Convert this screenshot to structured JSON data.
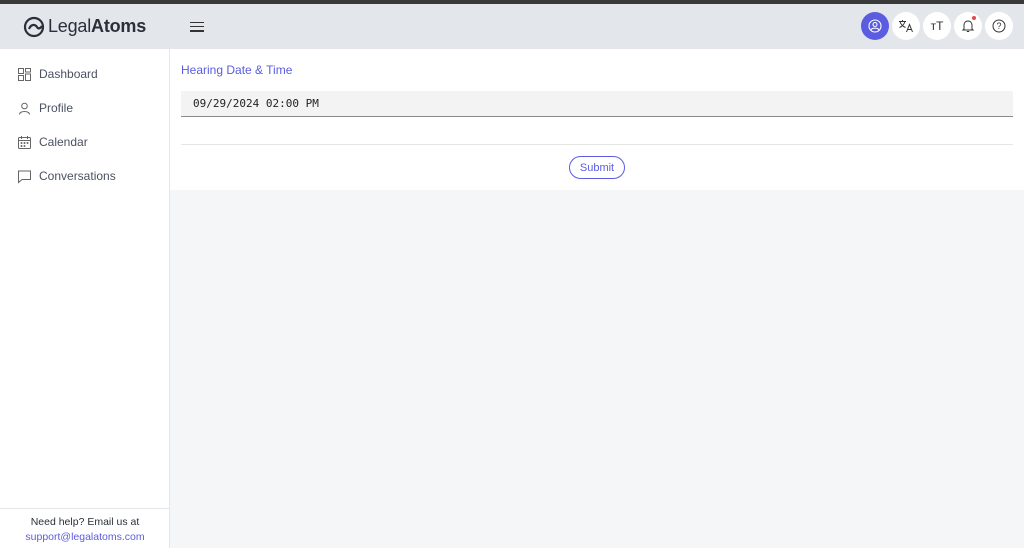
{
  "brand": {
    "name_light": "Legal",
    "name_bold": "Atoms"
  },
  "sidebar": {
    "items": [
      {
        "label": "Dashboard",
        "icon": "grid-icon"
      },
      {
        "label": "Profile",
        "icon": "user-icon"
      },
      {
        "label": "Calendar",
        "icon": "calendar-icon"
      },
      {
        "label": "Conversations",
        "icon": "chat-icon"
      }
    ],
    "footer": {
      "help_text": "Need help? Email us at",
      "email": "support@legalatoms.com"
    }
  },
  "header": {
    "icons": [
      "account-icon",
      "translate-icon",
      "text-size-icon",
      "bell-icon",
      "help-icon"
    ],
    "text_size_glyph": "тT",
    "help_glyph": "?"
  },
  "form": {
    "label": "Hearing Date & Time",
    "value": "09/29/2024 02:00 PM",
    "submit_label": "Submit"
  },
  "colors": {
    "accent": "#5b5ce0",
    "header_bg": "#e3e6ea",
    "notification": "#e24a4a"
  }
}
